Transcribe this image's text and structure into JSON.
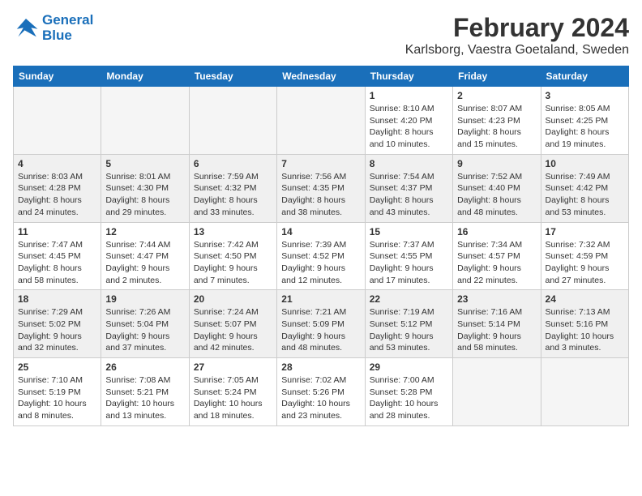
{
  "logo": {
    "line1": "General",
    "line2": "Blue"
  },
  "title": "February 2024",
  "subtitle": "Karlsborg, Vaestra Goetaland, Sweden",
  "days_of_week": [
    "Sunday",
    "Monday",
    "Tuesday",
    "Wednesday",
    "Thursday",
    "Friday",
    "Saturday"
  ],
  "weeks": [
    [
      {
        "day": "",
        "info": ""
      },
      {
        "day": "",
        "info": ""
      },
      {
        "day": "",
        "info": ""
      },
      {
        "day": "",
        "info": ""
      },
      {
        "day": "1",
        "info": "Sunrise: 8:10 AM\nSunset: 4:20 PM\nDaylight: 8 hours\nand 10 minutes."
      },
      {
        "day": "2",
        "info": "Sunrise: 8:07 AM\nSunset: 4:23 PM\nDaylight: 8 hours\nand 15 minutes."
      },
      {
        "day": "3",
        "info": "Sunrise: 8:05 AM\nSunset: 4:25 PM\nDaylight: 8 hours\nand 19 minutes."
      }
    ],
    [
      {
        "day": "4",
        "info": "Sunrise: 8:03 AM\nSunset: 4:28 PM\nDaylight: 8 hours\nand 24 minutes."
      },
      {
        "day": "5",
        "info": "Sunrise: 8:01 AM\nSunset: 4:30 PM\nDaylight: 8 hours\nand 29 minutes."
      },
      {
        "day": "6",
        "info": "Sunrise: 7:59 AM\nSunset: 4:32 PM\nDaylight: 8 hours\nand 33 minutes."
      },
      {
        "day": "7",
        "info": "Sunrise: 7:56 AM\nSunset: 4:35 PM\nDaylight: 8 hours\nand 38 minutes."
      },
      {
        "day": "8",
        "info": "Sunrise: 7:54 AM\nSunset: 4:37 PM\nDaylight: 8 hours\nand 43 minutes."
      },
      {
        "day": "9",
        "info": "Sunrise: 7:52 AM\nSunset: 4:40 PM\nDaylight: 8 hours\nand 48 minutes."
      },
      {
        "day": "10",
        "info": "Sunrise: 7:49 AM\nSunset: 4:42 PM\nDaylight: 8 hours\nand 53 minutes."
      }
    ],
    [
      {
        "day": "11",
        "info": "Sunrise: 7:47 AM\nSunset: 4:45 PM\nDaylight: 8 hours\nand 58 minutes."
      },
      {
        "day": "12",
        "info": "Sunrise: 7:44 AM\nSunset: 4:47 PM\nDaylight: 9 hours\nand 2 minutes."
      },
      {
        "day": "13",
        "info": "Sunrise: 7:42 AM\nSunset: 4:50 PM\nDaylight: 9 hours\nand 7 minutes."
      },
      {
        "day": "14",
        "info": "Sunrise: 7:39 AM\nSunset: 4:52 PM\nDaylight: 9 hours\nand 12 minutes."
      },
      {
        "day": "15",
        "info": "Sunrise: 7:37 AM\nSunset: 4:55 PM\nDaylight: 9 hours\nand 17 minutes."
      },
      {
        "day": "16",
        "info": "Sunrise: 7:34 AM\nSunset: 4:57 PM\nDaylight: 9 hours\nand 22 minutes."
      },
      {
        "day": "17",
        "info": "Sunrise: 7:32 AM\nSunset: 4:59 PM\nDaylight: 9 hours\nand 27 minutes."
      }
    ],
    [
      {
        "day": "18",
        "info": "Sunrise: 7:29 AM\nSunset: 5:02 PM\nDaylight: 9 hours\nand 32 minutes."
      },
      {
        "day": "19",
        "info": "Sunrise: 7:26 AM\nSunset: 5:04 PM\nDaylight: 9 hours\nand 37 minutes."
      },
      {
        "day": "20",
        "info": "Sunrise: 7:24 AM\nSunset: 5:07 PM\nDaylight: 9 hours\nand 42 minutes."
      },
      {
        "day": "21",
        "info": "Sunrise: 7:21 AM\nSunset: 5:09 PM\nDaylight: 9 hours\nand 48 minutes."
      },
      {
        "day": "22",
        "info": "Sunrise: 7:19 AM\nSunset: 5:12 PM\nDaylight: 9 hours\nand 53 minutes."
      },
      {
        "day": "23",
        "info": "Sunrise: 7:16 AM\nSunset: 5:14 PM\nDaylight: 9 hours\nand 58 minutes."
      },
      {
        "day": "24",
        "info": "Sunrise: 7:13 AM\nSunset: 5:16 PM\nDaylight: 10 hours\nand 3 minutes."
      }
    ],
    [
      {
        "day": "25",
        "info": "Sunrise: 7:10 AM\nSunset: 5:19 PM\nDaylight: 10 hours\nand 8 minutes."
      },
      {
        "day": "26",
        "info": "Sunrise: 7:08 AM\nSunset: 5:21 PM\nDaylight: 10 hours\nand 13 minutes."
      },
      {
        "day": "27",
        "info": "Sunrise: 7:05 AM\nSunset: 5:24 PM\nDaylight: 10 hours\nand 18 minutes."
      },
      {
        "day": "28",
        "info": "Sunrise: 7:02 AM\nSunset: 5:26 PM\nDaylight: 10 hours\nand 23 minutes."
      },
      {
        "day": "29",
        "info": "Sunrise: 7:00 AM\nSunset: 5:28 PM\nDaylight: 10 hours\nand 28 minutes."
      },
      {
        "day": "",
        "info": ""
      },
      {
        "day": "",
        "info": ""
      }
    ]
  ]
}
